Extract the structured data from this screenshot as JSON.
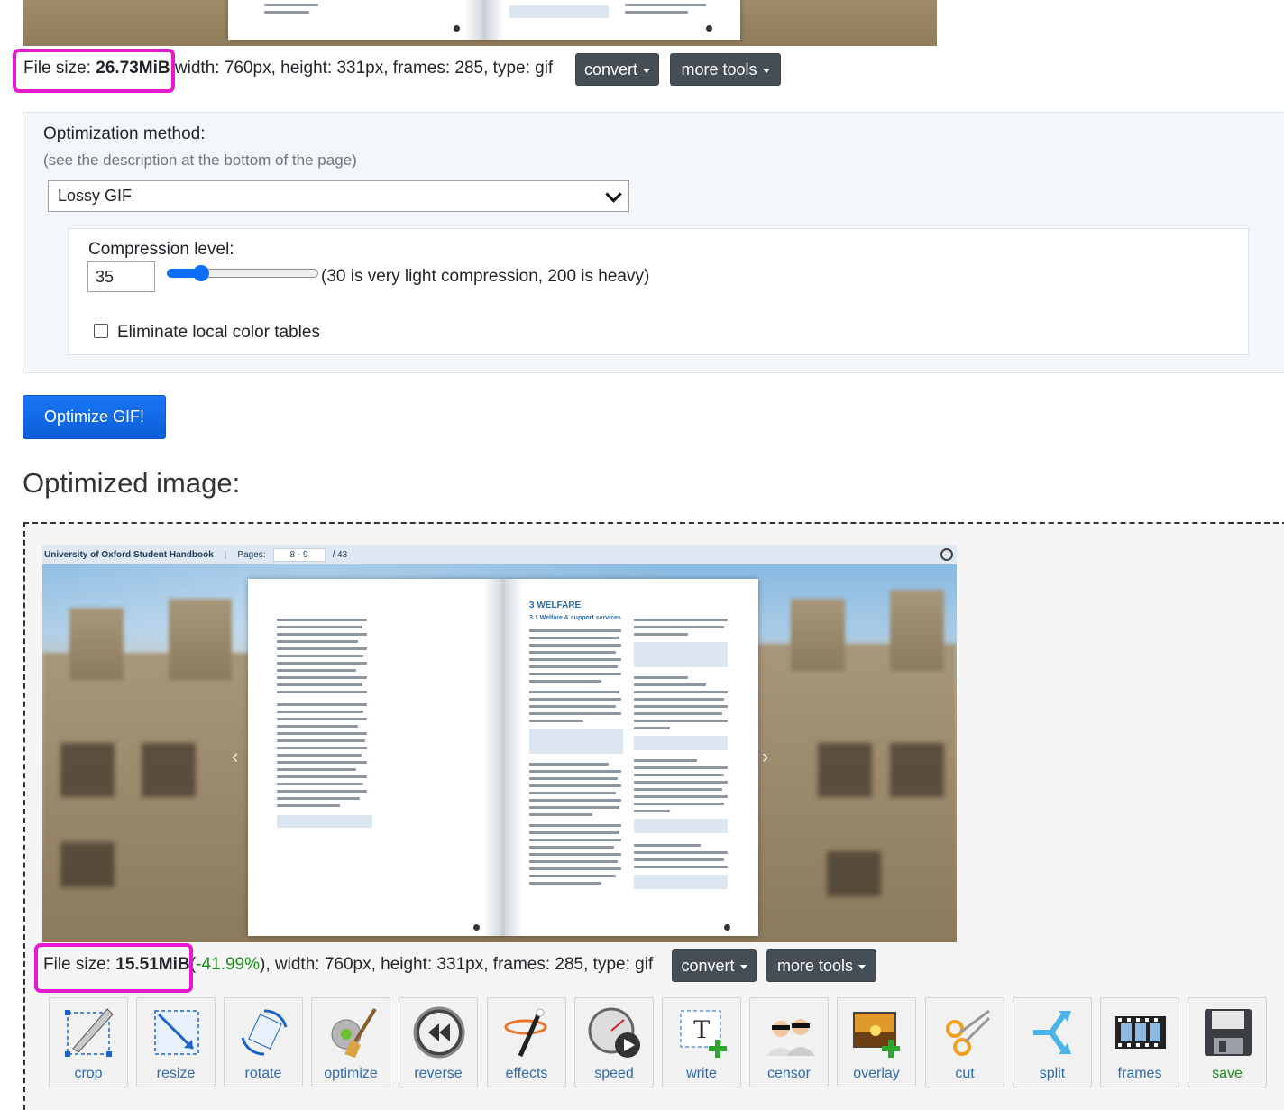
{
  "original": {
    "file_size_label": "File size: ",
    "file_size": "26.73MiB",
    "details": " width: 760px, height: 331px, frames: 285, type: gif",
    "convert_label": "convert",
    "more_tools_label": "more tools"
  },
  "optimization": {
    "method_label": "Optimization method:",
    "method_hint": "(see the description at the bottom of the page)",
    "method_selected": "Lossy GIF",
    "compression_label": "Compression level:",
    "compression_value": "35",
    "compression_level": 35,
    "compression_min": 30,
    "compression_max": 200,
    "compression_hint": "(30 is very light compression, 200 is heavy)",
    "eliminate_label": "Eliminate local color tables",
    "eliminate_checked": false,
    "submit_label": "Optimize GIF!"
  },
  "result": {
    "heading": "Optimized image:",
    "viewer_title": "University of Oxford Student Handbook",
    "viewer_pages_label": "Pages:",
    "viewer_pages": "8 - 9",
    "viewer_total": "/ 43",
    "book_section": "3 WELFARE",
    "book_subsection": "3.1 Welfare & support services",
    "file_size_label": "File size: ",
    "file_size": "15.51MiB",
    "reduction": "-41.99%",
    "details": "), width: 760px, height: 331px, frames: 285, type: gif",
    "paren_open": " (",
    "convert_label": "convert",
    "more_tools_label": "more tools"
  },
  "tools": [
    {
      "label": "crop",
      "icon": "crop-icon"
    },
    {
      "label": "resize",
      "icon": "resize-icon"
    },
    {
      "label": "rotate",
      "icon": "rotate-icon"
    },
    {
      "label": "optimize",
      "icon": "optimize-icon"
    },
    {
      "label": "reverse",
      "icon": "reverse-icon"
    },
    {
      "label": "effects",
      "icon": "effects-icon"
    },
    {
      "label": "speed",
      "icon": "speed-icon"
    },
    {
      "label": "write",
      "icon": "write-icon"
    },
    {
      "label": "censor",
      "icon": "censor-icon"
    },
    {
      "label": "overlay",
      "icon": "overlay-icon"
    },
    {
      "label": "cut",
      "icon": "cut-icon"
    },
    {
      "label": "split",
      "icon": "split-icon"
    },
    {
      "label": "frames",
      "icon": "frames-icon"
    },
    {
      "label": "save",
      "icon": "save-icon"
    }
  ],
  "colors": {
    "highlight": "#e519d0",
    "primary": "#0d6efd",
    "dark_button": "#454d55",
    "reduction_green": "#1a8a1a"
  }
}
